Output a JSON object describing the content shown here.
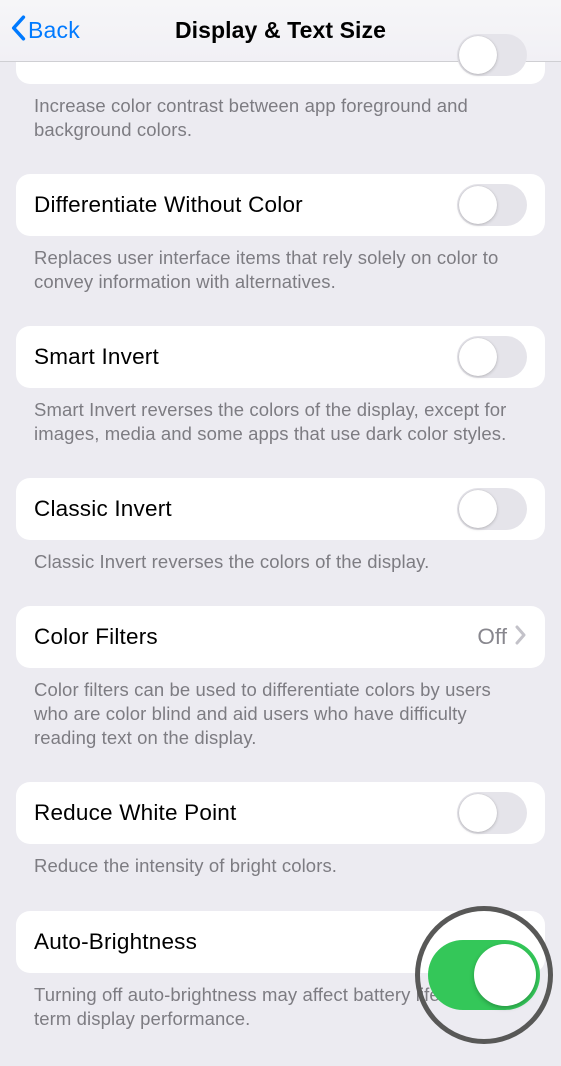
{
  "nav": {
    "back": "Back",
    "title": "Display & Text Size"
  },
  "section0": {
    "footer": "Increase color contrast between app foreground and background colors."
  },
  "section1": {
    "label": "Differentiate Without Color",
    "footer": "Replaces user interface items that rely solely on color to convey information with alternatives."
  },
  "section2": {
    "label": "Smart Invert",
    "footer": "Smart Invert reverses the colors of the display, except for images, media and some apps that use dark color styles."
  },
  "section3": {
    "label": "Classic Invert",
    "footer": "Classic Invert reverses the colors of the display."
  },
  "section4": {
    "label": "Color Filters",
    "value": "Off",
    "footer": "Color filters can be used to differentiate colors by users who are color blind and aid users who have difficulty reading text on the display."
  },
  "section5": {
    "label": "Reduce White Point",
    "footer": "Reduce the intensity of bright colors."
  },
  "section6": {
    "label": "Auto-Brightness",
    "footer": "Turning off auto-brightness may affect battery life and long-term display performance."
  }
}
